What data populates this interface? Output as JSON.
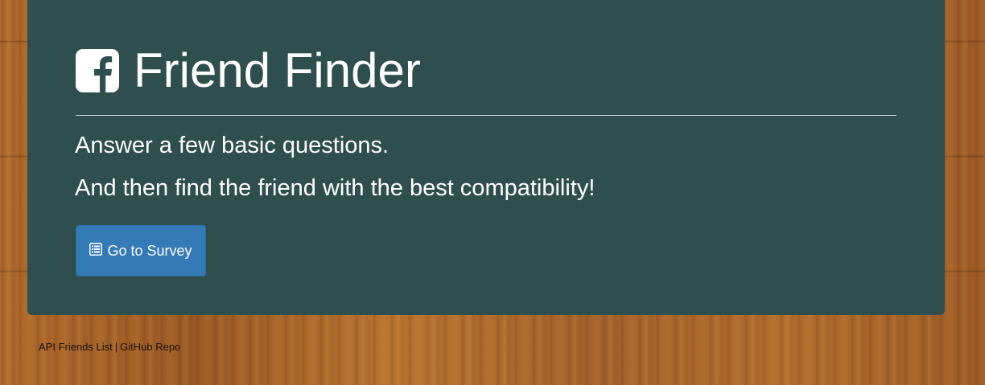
{
  "header": {
    "title": "Friend Finder",
    "title_icon": "facebook-square-icon"
  },
  "main": {
    "lead_line_1": "Answer a few basic questions.",
    "lead_line_2": "And then find the friend with the best compatibility!",
    "survey_button": {
      "label": "Go to Survey",
      "icon": "list-alt-icon"
    }
  },
  "footer": {
    "links": [
      {
        "label": "API Friends List"
      },
      {
        "label": "GitHub Repo"
      }
    ],
    "separator": "|"
  },
  "colors": {
    "panel": "#2f4f4f",
    "button": "#337ab7",
    "text": "#ffffff",
    "wood": "#a8642a"
  }
}
